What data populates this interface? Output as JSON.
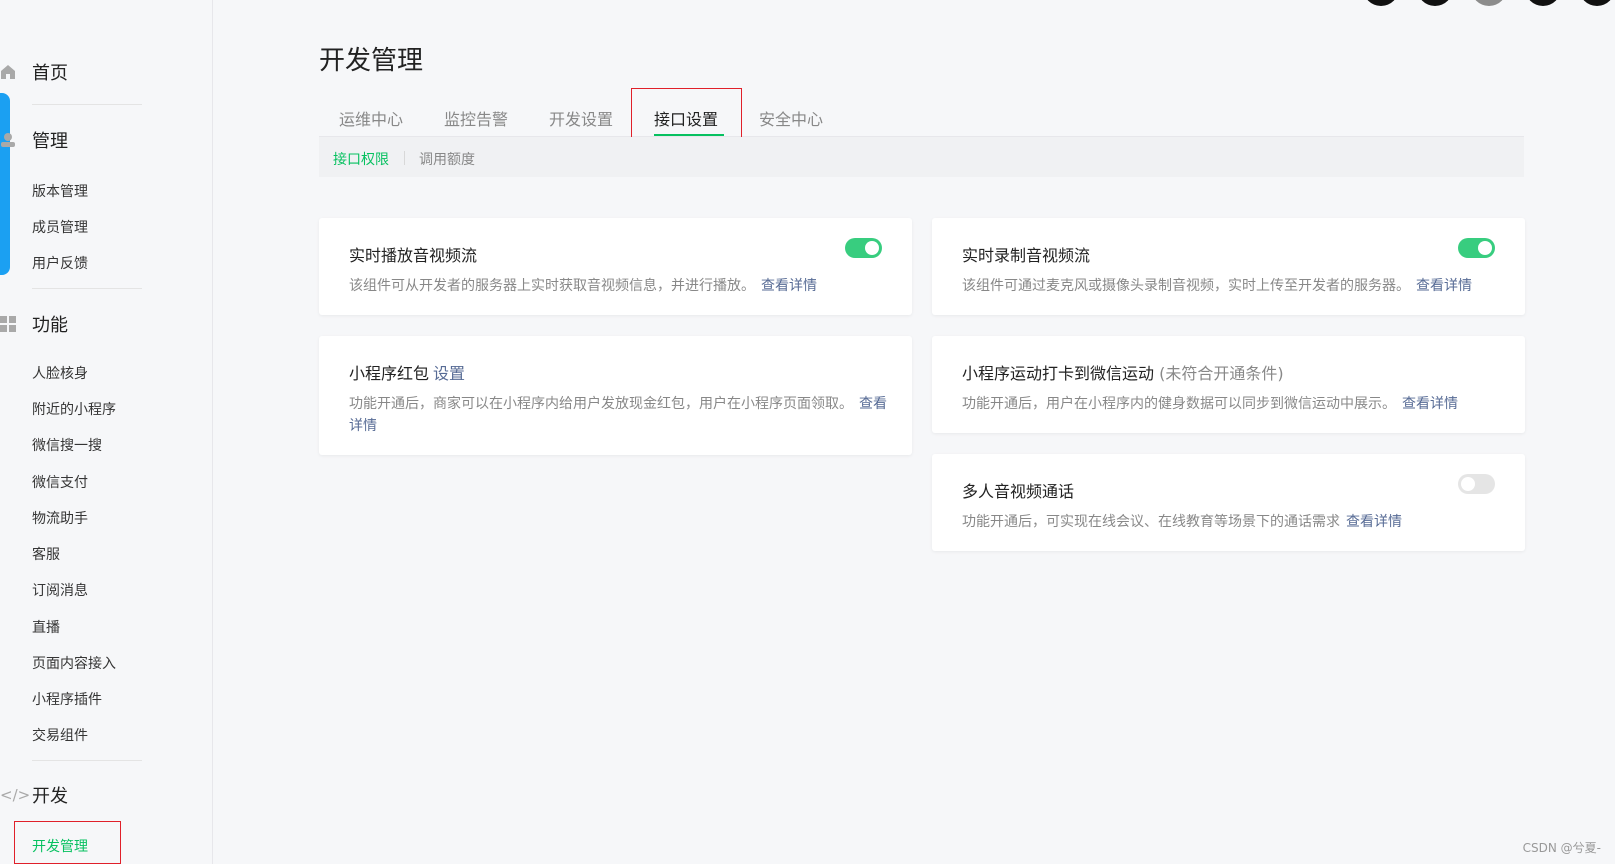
{
  "sidebar": {
    "home": {
      "label": "首页",
      "icon": "home-icon"
    },
    "manage": {
      "label": "管理",
      "icon": "manage-icon",
      "items": [
        {
          "label": "版本管理"
        },
        {
          "label": "成员管理"
        },
        {
          "label": "用户反馈"
        }
      ]
    },
    "features": {
      "label": "功能",
      "icon": "grid-icon",
      "items": [
        {
          "label": "人脸核身"
        },
        {
          "label": "附近的小程序"
        },
        {
          "label": "微信搜一搜"
        },
        {
          "label": "微信支付"
        },
        {
          "label": "物流助手"
        },
        {
          "label": "客服"
        },
        {
          "label": "订阅消息"
        },
        {
          "label": "直播"
        },
        {
          "label": "页面内容接入"
        },
        {
          "label": "小程序插件"
        },
        {
          "label": "交易组件"
        }
      ]
    },
    "dev": {
      "label": "开发",
      "icon": "code-icon",
      "items": [
        {
          "label": "开发管理",
          "active": true
        }
      ]
    }
  },
  "main": {
    "title": "开发管理",
    "tabs": [
      {
        "label": "运维中心"
      },
      {
        "label": "监控告警"
      },
      {
        "label": "开发设置"
      },
      {
        "label": "接口设置",
        "active": true
      },
      {
        "label": "安全中心"
      }
    ],
    "subtabs": [
      {
        "label": "接口权限",
        "active": true
      },
      {
        "label": "调用额度"
      }
    ],
    "cards": [
      {
        "title": "实时播放音视频流",
        "desc": "该组件可从开发者的服务器上实时获取音视频信息，并进行播放。",
        "link": "查看详情",
        "toggle": "on"
      },
      {
        "title": "实时录制音视频流",
        "desc": "该组件可通过麦克风或摄像头录制音视频，实时上传至开发者的服务器。",
        "link": "查看详情",
        "toggle": "on"
      },
      {
        "title": "小程序红包",
        "title_link": "设置",
        "desc": "功能开通后，商家可以在小程序内给用户发放现金红包，用户在小程序页面领取。",
        "link": "查看详情"
      },
      {
        "title": "小程序运动打卡到微信运动",
        "title_note": "(未符合开通条件)",
        "desc": "功能开通后，用户在小程序内的健身数据可以同步到微信运动中展示。",
        "link": "查看详情"
      },
      {
        "title": "多人音视频通话",
        "desc": "功能开通后，可实现在线会议、在线教育等场景下的通话需求",
        "link": "查看详情",
        "toggle": "off"
      }
    ]
  },
  "colors": {
    "accent": "#07c160",
    "link": "#576b95",
    "highlight": "#e0202a",
    "side_tab": "#1ba0f2"
  },
  "watermark": "CSDN @兮夏-"
}
